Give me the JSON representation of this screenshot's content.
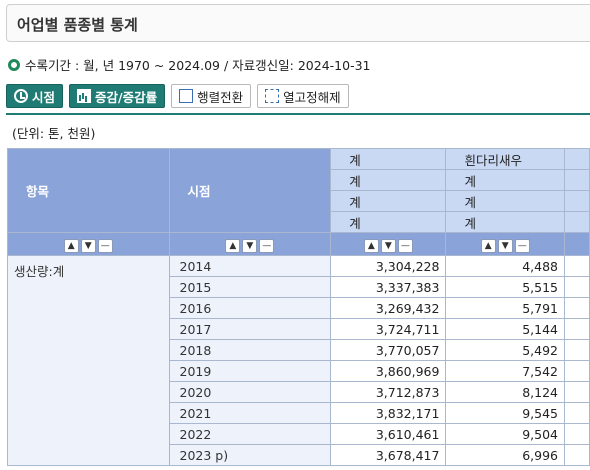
{
  "page": {
    "title": "어업별 품종별 통계"
  },
  "info": {
    "period": "수록기간 : 월, 년 1970 ~ 2024.09 / 자료갱신일: 2024-10-31"
  },
  "toolbar": {
    "time_label": "시점",
    "change_label": "증감/증감률",
    "pivot_label": "행렬전환",
    "fix_label": "열고정해제"
  },
  "unit": "(단위: 톤, 천원)",
  "table": {
    "col_item": "항목",
    "col_time": "시점",
    "col1_levels": [
      "계",
      "계",
      "계",
      "계"
    ],
    "col2_levels": [
      "흰다리새우",
      "계",
      "계",
      "계"
    ],
    "item_label": "생산량:계",
    "rows": [
      {
        "time": "2014",
        "v1": "3,304,228",
        "v2": "4,488"
      },
      {
        "time": "2015",
        "v1": "3,337,383",
        "v2": "5,515"
      },
      {
        "time": "2016",
        "v1": "3,269,432",
        "v2": "5,791"
      },
      {
        "time": "2017",
        "v1": "3,724,711",
        "v2": "5,144"
      },
      {
        "time": "2018",
        "v1": "3,770,057",
        "v2": "5,492"
      },
      {
        "time": "2019",
        "v1": "3,860,969",
        "v2": "7,542"
      },
      {
        "time": "2020",
        "v1": "3,712,873",
        "v2": "8,124"
      },
      {
        "time": "2021",
        "v1": "3,832,171",
        "v2": "9,545"
      },
      {
        "time": "2022",
        "v1": "3,610,461",
        "v2": "9,504"
      },
      {
        "time": "2023 p)",
        "v1": "3,678,417",
        "v2": "6,996"
      }
    ]
  }
}
